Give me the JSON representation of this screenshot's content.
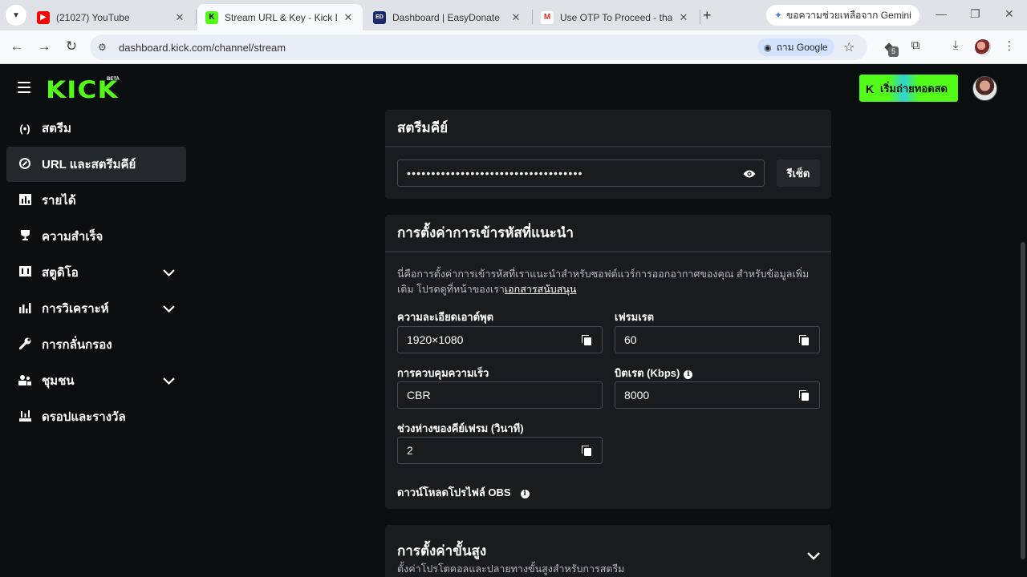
{
  "browser": {
    "tabs": [
      {
        "title": "(21027) YouTube",
        "favicon": "youtube-icon"
      },
      {
        "title": "Stream URL & Key - Kick Das",
        "favicon": "kick-icon",
        "active": true
      },
      {
        "title": "Dashboard | EasyDonate",
        "favicon": "easydonate-icon"
      },
      {
        "title": "Use OTP To Proceed - thawn",
        "favicon": "gmail-icon"
      }
    ],
    "gemini_tab": "ขอความช่วยเหลือจาก Gemini",
    "url": "dashboard.kick.com/channel/stream",
    "google_chip": "ถาม Google",
    "extension_badge": "5"
  },
  "header": {
    "logo": "KICK",
    "beta": "BETA",
    "go_live_label": "เริ่มถ่ายทอดสด"
  },
  "sidebar": {
    "items": [
      {
        "label": "สตรีม",
        "icon": "broadcast-icon"
      },
      {
        "label": "URL และสตรีมคีย์",
        "icon": "link-icon",
        "active": true
      },
      {
        "label": "รายได้",
        "icon": "revenue-icon"
      },
      {
        "label": "ความสำเร็จ",
        "icon": "trophy-icon"
      },
      {
        "label": "สตูดิโอ",
        "icon": "studio-icon",
        "expandable": true
      },
      {
        "label": "การวิเคราะห์",
        "icon": "analytics-icon",
        "expandable": true
      },
      {
        "label": "การกลั่นกรอง",
        "icon": "wrench-icon"
      },
      {
        "label": "ชุมชน",
        "icon": "community-icon",
        "expandable": true
      },
      {
        "label": "ดรอปและรางวัล",
        "icon": "drops-icon"
      }
    ]
  },
  "stream_key": {
    "title": "สตรีมคีย์",
    "value": "••••••••••••••••••••••••••••••••••••",
    "reset_label": "รีเซ็ต"
  },
  "encoder": {
    "title": "การตั้งค่าการเข้ารหัสที่แนะนำ",
    "description": "นี่คือการตั้งค่าการเข้ารหัสที่เราแนะนำสำหรับซอฟต์แวร์การออกอากาศของคุณ สำหรับข้อมูลเพิ่มเติม โปรดดูที่หน้าของเรา",
    "doc_link": "เอกสารสนับสนุน",
    "resolution_label": "ความละเอียดเอาต์พุต",
    "resolution_value": "1920×1080",
    "framerate_label": "เฟรมเรต",
    "framerate_value": "60",
    "rate_control_label": "การควบคุมความเร็ว",
    "rate_control_value": "CBR",
    "bitrate_label": "บิตเรต (Kbps)",
    "bitrate_value": "8000",
    "keyframe_label": "ช่วงห่างของคีย์เฟรม (วินาที)",
    "keyframe_value": "2",
    "obs_label": "ดาวน์โหลดโปรไฟล์ OBS"
  },
  "advanced": {
    "title": "การตั้งค่าขั้นสูง",
    "subtitle": "ตั้งค่าโปรโตคอลและปลายทางขั้นสูงสำหรับการสตรีม"
  },
  "colors": {
    "accent": "#53fc18",
    "background": "#0b0e0f",
    "card": "#191b1f"
  }
}
